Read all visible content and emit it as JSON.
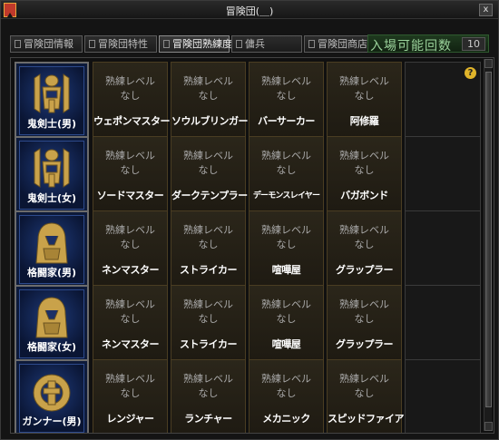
{
  "window": {
    "title": "冒険団(＿)",
    "close_label": "x"
  },
  "tabs": [
    {
      "label": "冒険団情報",
      "active": false
    },
    {
      "label": "冒険団特性",
      "active": false
    },
    {
      "label": "冒険団熟練度",
      "active": true
    },
    {
      "label": "傭兵",
      "active": false
    },
    {
      "label": "冒険団商店",
      "active": false
    }
  ],
  "entry": {
    "label": "入場可能回数",
    "value": "10"
  },
  "help_label": "?",
  "rows": [
    {
      "character": "鬼剣士(男)",
      "icon": "ghost-knight-emblem-icon",
      "cells": [
        {
          "level": "熟練レベル",
          "status": "なし",
          "name": "ウェポンマスター"
        },
        {
          "level": "熟練レベル",
          "status": "なし",
          "name": "ソウルブリンガー"
        },
        {
          "level": "熟練レベル",
          "status": "なし",
          "name": "バーサーカー"
        },
        {
          "level": "熟練レベル",
          "status": "なし",
          "name": "阿修羅"
        }
      ]
    },
    {
      "character": "鬼剣士(女)",
      "icon": "ghost-knight-emblem-icon",
      "cells": [
        {
          "level": "熟練レベル",
          "status": "なし",
          "name": "ソードマスター"
        },
        {
          "level": "熟練レベル",
          "status": "なし",
          "name": "ダークテンプラー"
        },
        {
          "level": "熟練レベル",
          "status": "なし",
          "name": "デーモンスレイヤー"
        },
        {
          "level": "熟練レベル",
          "status": "なし",
          "name": "バガボンド"
        }
      ]
    },
    {
      "character": "格闘家(男)",
      "icon": "fighter-emblem-icon",
      "cells": [
        {
          "level": "熟練レベル",
          "status": "なし",
          "name": "ネンマスター"
        },
        {
          "level": "熟練レベル",
          "status": "なし",
          "name": "ストライカー"
        },
        {
          "level": "熟練レベル",
          "status": "なし",
          "name": "喧嘩屋"
        },
        {
          "level": "熟練レベル",
          "status": "なし",
          "name": "グラップラー"
        }
      ]
    },
    {
      "character": "格闘家(女)",
      "icon": "fighter-emblem-icon",
      "cells": [
        {
          "level": "熟練レベル",
          "status": "なし",
          "name": "ネンマスター"
        },
        {
          "level": "熟練レベル",
          "status": "なし",
          "name": "ストライカー"
        },
        {
          "level": "熟練レベル",
          "status": "なし",
          "name": "喧嘩屋"
        },
        {
          "level": "熟練レベル",
          "status": "なし",
          "name": "グラップラー"
        }
      ]
    },
    {
      "character": "ガンナー(男)",
      "icon": "gunner-emblem-icon",
      "cells": [
        {
          "level": "熟練レベル",
          "status": "なし",
          "name": "レンジャー"
        },
        {
          "level": "熟練レベル",
          "status": "なし",
          "name": "ランチャー"
        },
        {
          "level": "熟練レベル",
          "status": "なし",
          "name": "メカニック"
        },
        {
          "level": "熟練レベル",
          "status": "なし",
          "name": "スピッドファイア"
        }
      ]
    }
  ],
  "colors": {
    "accent_gold": "#e0b42a",
    "emblem_gold": "#c9a24a",
    "panel_blue": "#0d1a3a"
  }
}
